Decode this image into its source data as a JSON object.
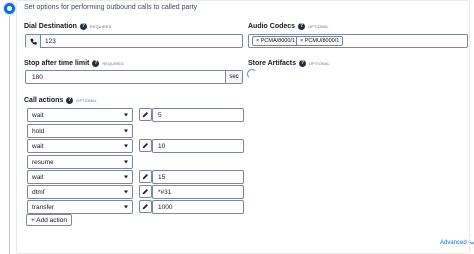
{
  "header": {
    "description": "Set options for performing outbound calls to called party"
  },
  "dial_destination": {
    "label": "Dial Destination",
    "tag": "REQUIRED",
    "value": "123"
  },
  "audio_codecs": {
    "label": "Audio Codecs",
    "tag": "OPTIONAL",
    "tokens": [
      "× PCMA/8000/1",
      "× PCMU/8000/1"
    ]
  },
  "stop_after": {
    "label": "Stop after time limit",
    "tag": "REQUIRED",
    "value": "180",
    "unit": "sec"
  },
  "store_artifacts": {
    "label": "Store Artifacts",
    "tag": "OPTIONAL"
  },
  "call_actions": {
    "label": "Call actions",
    "tag": "OPTIONAL",
    "rows": [
      {
        "action": "wait",
        "value": "5"
      },
      {
        "action": "hold",
        "value": ""
      },
      {
        "action": "wait",
        "value": "10"
      },
      {
        "action": "resume",
        "value": ""
      },
      {
        "action": "wait",
        "value": "15"
      },
      {
        "action": "dtmf",
        "value": "*#31"
      },
      {
        "action": "transfer",
        "value": "1000"
      }
    ],
    "add_label": "+ Add action"
  },
  "footer": {
    "advanced_label": "Advanced",
    "advanced_icon": "chevron-down-icon"
  },
  "colors": {
    "accent": "#0972d3",
    "border": "#7d8998",
    "text": "#16191f"
  }
}
